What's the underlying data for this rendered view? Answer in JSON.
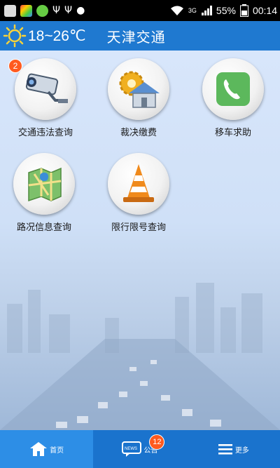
{
  "status_bar": {
    "network": "3G",
    "battery": "55%",
    "time": "00:14"
  },
  "header": {
    "weather_icon": "sun-icon",
    "temperature": "18~26℃",
    "title": "天津交通"
  },
  "menu": [
    {
      "label": "交通违法查询",
      "icon": "traffic-camera-icon",
      "badge": "2"
    },
    {
      "label": "裁决缴费",
      "icon": "house-gear-icon"
    },
    {
      "label": "移车求助",
      "icon": "phone-icon"
    },
    {
      "label": "路况信息查询",
      "icon": "map-icon"
    },
    {
      "label": "限行限号查询",
      "icon": "traffic-cone-icon"
    }
  ],
  "bottom_nav": [
    {
      "label": "首页",
      "icon": "home-icon",
      "active": true
    },
    {
      "label": "公告",
      "icon": "news-icon",
      "badge": "12"
    },
    {
      "label": "更多",
      "icon": "menu-icon"
    }
  ],
  "colors": {
    "header_bg": "#1f79d0",
    "nav_bg": "#1a73cd",
    "badge": "#ff5a1f",
    "phone_green": "#5cb85c"
  }
}
